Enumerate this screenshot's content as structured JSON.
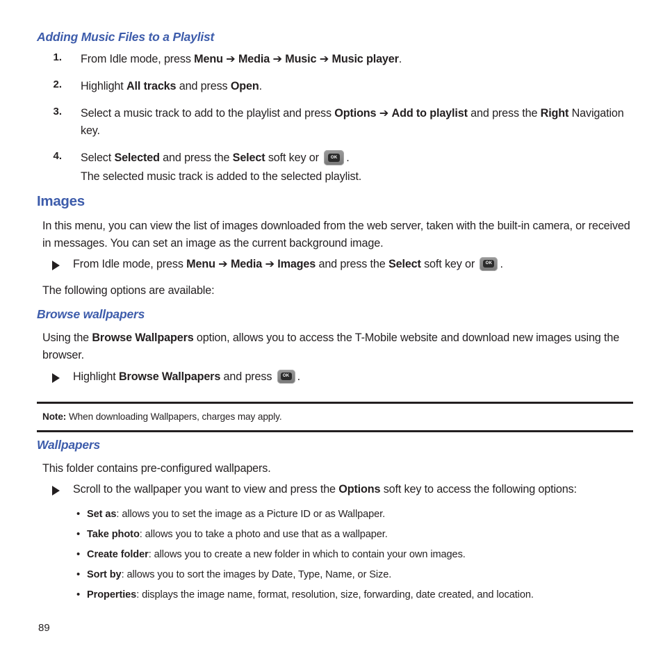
{
  "page": {
    "number": "89",
    "heading_color": "#3d5cab",
    "text_color": "#231f20"
  },
  "section_playlist": {
    "heading": "Adding Music Files to a Playlist",
    "steps": [
      {
        "number": "1.",
        "pre": "From Idle mode, press ",
        "b1": "Menu",
        "arrow1": "➔",
        "b2": "Media",
        "arrow2": "➔",
        "b3": "Music",
        "arrow3": "➔",
        "b4": "Music player",
        "post": "."
      },
      {
        "number": "2.",
        "pre": "Highlight ",
        "b1": "All tracks",
        "mid": " and press ",
        "b2": "Open",
        "post": "."
      },
      {
        "number": "3.",
        "pre": "Select a music track to add to the playlist and press ",
        "b1": "Options",
        "arrow1": "➔",
        "b2": "Add to playlist",
        "mid": " and press the ",
        "b3": "Right",
        "post": " Navigation key."
      },
      {
        "number": "4.",
        "pre": "Select ",
        "b1": "Selected",
        "mid": " and press the ",
        "b2": "Select",
        "post": " soft key or ",
        "tail": ".",
        "extra_line": "The selected music track is added to the selected playlist."
      }
    ]
  },
  "section_images": {
    "heading": "Images",
    "intro": "In this menu, you can view the list of images downloaded from the web server, taken with the built-in camera, or received in messages. You can set an image as the current background image.",
    "bullet": {
      "pre": "From Idle mode, press ",
      "b1": "Menu",
      "arrow1": "➔",
      "b2": "Media",
      "arrow2": "➔",
      "b3": "Images",
      "mid": " and press the ",
      "b4": "Select",
      "post": " soft key or ",
      "tail": "."
    },
    "options_intro": "The following options are available:"
  },
  "section_browse": {
    "heading": "Browse wallpapers",
    "paragraph": {
      "pre": "Using the ",
      "b1": "Browse Wallpapers",
      "post": " option, allows you to access the T-Mobile website and download new images using the browser."
    },
    "bullet": {
      "pre": "Highlight ",
      "b1": "Browse Wallpapers",
      "mid": " and press ",
      "tail": "."
    }
  },
  "note": {
    "label": "Note:",
    "text": "When downloading Wallpapers, charges may apply."
  },
  "section_wallpapers": {
    "heading": "Wallpapers",
    "intro": "This folder contains pre-configured wallpapers.",
    "bullet": {
      "pre": "Scroll to the wallpaper you want to view and press the ",
      "b1": "Options",
      "post": " soft key to access the following options:"
    },
    "options": [
      {
        "bullet": "•",
        "term": "Set as",
        "desc": ": allows you to set the image as a Picture ID or as Wallpaper."
      },
      {
        "bullet": "•",
        "term": "Take photo",
        "desc": ": allows you to take a photo and use that as a wallpaper."
      },
      {
        "bullet": "•",
        "term": "Create folder",
        "desc": ": allows you to create a new folder in which to contain your own images."
      },
      {
        "bullet": "•",
        "term": "Sort by",
        "desc": ": allows you to sort the images by Date, Type, Name, or Size."
      },
      {
        "bullet": "•",
        "term": "Properties",
        "desc": ": displays the image name, format, resolution, size, forwarding, date created, and location."
      }
    ]
  },
  "okkey": {
    "label": "OK"
  }
}
